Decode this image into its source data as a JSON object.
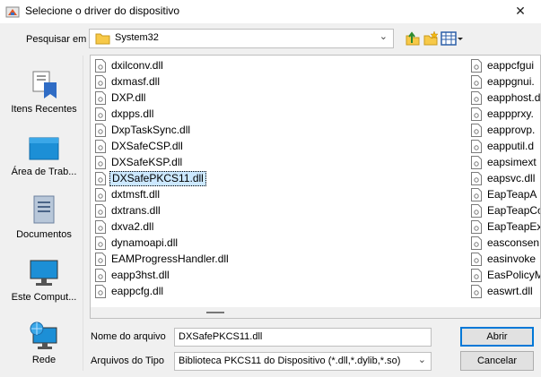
{
  "window": {
    "title": "Selecione o driver do dispositivo",
    "close_glyph": "✕"
  },
  "toolbar": {
    "look_in_label": "Pesquisar em",
    "look_in_value": "System32",
    "buttons": [
      "up-folder-icon",
      "new-folder-icon",
      "view-menu-icon"
    ]
  },
  "places": [
    {
      "label": "Itens Recentes",
      "icon": "recent-items-icon"
    },
    {
      "label": "Área de Trab...",
      "icon": "desktop-icon"
    },
    {
      "label": "Documentos",
      "icon": "documents-icon"
    },
    {
      "label": "Este Comput...",
      "icon": "computer-icon"
    },
    {
      "label": "Rede",
      "icon": "network-icon"
    }
  ],
  "files_col1": [
    "dxilconv.dll",
    "dxmasf.dll",
    "DXP.dll",
    "dxpps.dll",
    "DxpTaskSync.dll",
    "DXSafeCSP.dll",
    "DXSafeKSP.dll",
    "DXSafePKCS11.dll",
    "dxtmsft.dll",
    "dxtrans.dll",
    "dxva2.dll",
    "dynamoapi.dll",
    "EAMProgressHandler.dll",
    "eapp3hst.dll",
    "eappcfg.dll"
  ],
  "files_col2": [
    "eappcfgui",
    "eappgnui.",
    "eapphost.d",
    "eappprxy.",
    "eapprovp.",
    "eapputil.d",
    "eapsimext",
    "eapsvc.dll",
    "EapTeapA",
    "EapTeapCo",
    "EapTeapEx",
    "easconsen",
    "easinvoke",
    "EasPolicyM",
    "easwrt.dll"
  ],
  "selected_file": "DXSafePKCS11.dll",
  "form": {
    "filename_label": "Nome do arquivo",
    "filename_value": "DXSafePKCS11.dll",
    "filetype_label": "Arquivos do Tipo",
    "filetype_value": "Biblioteca PKCS11 do Dispositivo (*.dll,*.dylib,*.so)",
    "open_label": "Abrir",
    "cancel_label": "Cancelar"
  },
  "colors": {
    "selection": "#cce8ff",
    "default_button_border": "#0078d7",
    "folder_yellow": "#f7c948"
  }
}
